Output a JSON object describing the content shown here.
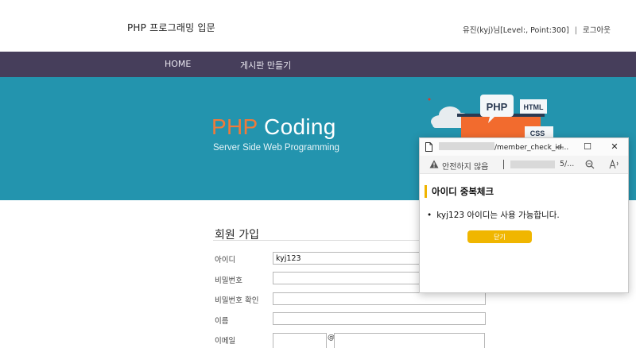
{
  "header": {
    "site_title": "PHP 프로그래밍 입문",
    "user_info": "유진(kyj)님[Level:, Point:300]",
    "logout_label": "로그아웃"
  },
  "nav": {
    "items": [
      {
        "label": "HOME"
      },
      {
        "label": "게시판 만들기"
      }
    ]
  },
  "banner": {
    "title_php": "PHP",
    "title_rest": " Coding",
    "subtitle": "Server Side Web Programming",
    "art_labels": {
      "php": "PHP",
      "html": "HTML",
      "css": "CSS"
    },
    "colors": {
      "bg": "#2394ae",
      "php_accent": "#f07a3a"
    }
  },
  "form": {
    "title": "회원 가입",
    "fields": [
      {
        "label": "아이디",
        "value": "kyj123"
      },
      {
        "label": "비밀번호",
        "value": ""
      },
      {
        "label": "비밀번호 확인",
        "value": ""
      },
      {
        "label": "이름",
        "value": ""
      },
      {
        "label": "이메일",
        "value": "",
        "separator": "@"
      }
    ]
  },
  "popup": {
    "url_path": "/member_check_id...",
    "security_text": "안전하지 않음",
    "addr_tail": "5/...",
    "heading": "아이디 중복체크",
    "message": "kyj123 아이디는 사용 가능합니다.",
    "close_label": "닫기",
    "accent_color": "#f0b600",
    "window_controls": {
      "minimize": "—",
      "maximize": "☐",
      "close": "✕"
    }
  }
}
